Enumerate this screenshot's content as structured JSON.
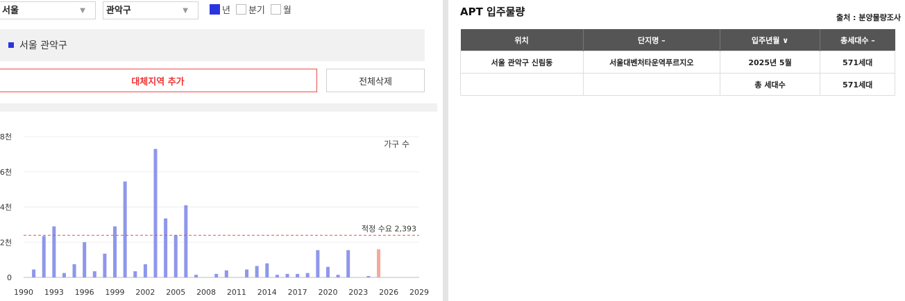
{
  "filters": {
    "city": "서울",
    "district": "관악구",
    "period_options": [
      {
        "label": "년",
        "checked": true
      },
      {
        "label": "분기",
        "checked": false
      },
      {
        "label": "월",
        "checked": false
      }
    ]
  },
  "selected_region": "서울 관악구",
  "buttons": {
    "add_region": "대체지역 추가",
    "delete_all": "전체삭제"
  },
  "colors": {
    "bar": "#8e97ea",
    "bar_future": "#f5a89b",
    "threshold": "#e05050",
    "accent": "#2a35e0"
  },
  "chart_data": {
    "type": "bar",
    "series_label": "가구 수",
    "ylim": [
      0,
      8000
    ],
    "yticks": [
      {
        "v": 0,
        "label": "0"
      },
      {
        "v": 2000,
        "label": "2천"
      },
      {
        "v": 4000,
        "label": "4천"
      },
      {
        "v": 6000,
        "label": "6천"
      },
      {
        "v": 8000,
        "label": "8천"
      }
    ],
    "xlim": [
      1990,
      2029
    ],
    "xticks": [
      1990,
      1993,
      1996,
      1999,
      2002,
      2005,
      2008,
      2011,
      2014,
      2017,
      2020,
      2023,
      2026,
      2029
    ],
    "threshold": {
      "value": 2393,
      "label": "적정 수요 2,393"
    },
    "bars": [
      {
        "year": 1991,
        "value": 450
      },
      {
        "year": 1992,
        "value": 2350
      },
      {
        "year": 1993,
        "value": 2900
      },
      {
        "year": 1994,
        "value": 250
      },
      {
        "year": 1995,
        "value": 750
      },
      {
        "year": 1996,
        "value": 2000
      },
      {
        "year": 1997,
        "value": 350
      },
      {
        "year": 1998,
        "value": 1350
      },
      {
        "year": 1999,
        "value": 2900
      },
      {
        "year": 2000,
        "value": 5450
      },
      {
        "year": 2001,
        "value": 350
      },
      {
        "year": 2002,
        "value": 750
      },
      {
        "year": 2003,
        "value": 7300
      },
      {
        "year": 2004,
        "value": 3350
      },
      {
        "year": 2005,
        "value": 2400
      },
      {
        "year": 2006,
        "value": 4100
      },
      {
        "year": 2007,
        "value": 150
      },
      {
        "year": 2009,
        "value": 200
      },
      {
        "year": 2010,
        "value": 400
      },
      {
        "year": 2012,
        "value": 450
      },
      {
        "year": 2013,
        "value": 650
      },
      {
        "year": 2014,
        "value": 800
      },
      {
        "year": 2015,
        "value": 150
      },
      {
        "year": 2016,
        "value": 200
      },
      {
        "year": 2017,
        "value": 200
      },
      {
        "year": 2018,
        "value": 250
      },
      {
        "year": 2019,
        "value": 1550
      },
      {
        "year": 2020,
        "value": 600
      },
      {
        "year": 2021,
        "value": 150
      },
      {
        "year": 2022,
        "value": 1550
      },
      {
        "year": 2024,
        "value": 80
      },
      {
        "year": 2025,
        "value": 1600,
        "future": true
      }
    ]
  },
  "apt": {
    "title": "APT 입주물량",
    "source": "출처 : 분양물량조사",
    "headers": [
      "위치",
      "단지명 –",
      "입주년월 ∨",
      "총세대수 –"
    ],
    "rows": [
      [
        "서울 관악구 신림동",
        "서울대벤처타운역푸르지오",
        "2025년 5월",
        "571세대"
      ],
      [
        "",
        "",
        "총 세대수",
        "571세대"
      ]
    ]
  }
}
